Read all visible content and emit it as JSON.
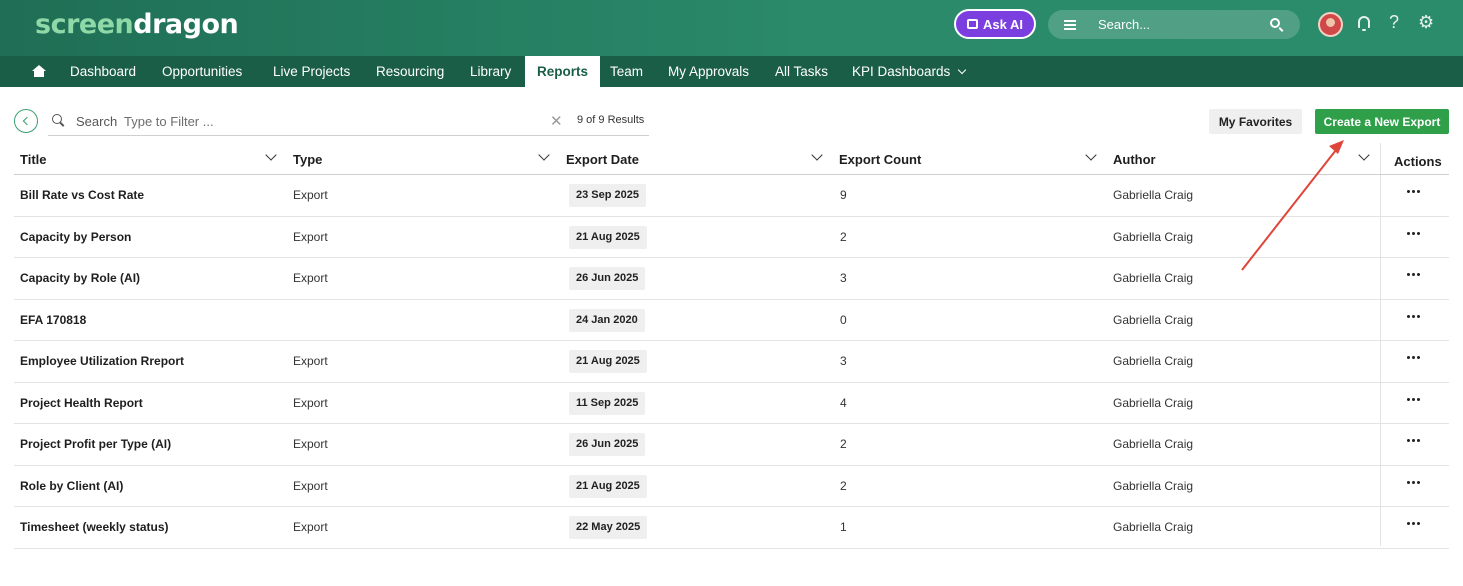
{
  "brand": {
    "part1": "screen",
    "part2": "dragon"
  },
  "header": {
    "ask_ai_label": "Ask AI",
    "search_placeholder": "Search..."
  },
  "nav": {
    "items": [
      {
        "label": "Dashboard"
      },
      {
        "label": "Opportunities"
      },
      {
        "label": "Live Projects"
      },
      {
        "label": "Resourcing"
      },
      {
        "label": "Library"
      },
      {
        "label": "Reports",
        "active": true
      },
      {
        "label": "Team"
      },
      {
        "label": "My Approvals"
      },
      {
        "label": "All Tasks"
      },
      {
        "label": "KPI Dashboards",
        "has_dropdown": true
      }
    ]
  },
  "toolbar": {
    "search_label": "Search",
    "filter_placeholder": "Type to Filter ...",
    "results_count": "9 of 9 Results",
    "favorites_label": "My Favorites",
    "create_label": "Create a New Export"
  },
  "table": {
    "columns": [
      "Title",
      "Type",
      "Export Date",
      "Export Count",
      "Author",
      "Actions"
    ],
    "rows": [
      {
        "title": "Bill Rate vs Cost Rate",
        "type": "Export",
        "date": "23 Sep 2025",
        "count": "9",
        "author": "Gabriella Craig"
      },
      {
        "title": "Capacity by Person",
        "type": "Export",
        "date": "21 Aug 2025",
        "count": "2",
        "author": "Gabriella Craig"
      },
      {
        "title": "Capacity by Role (AI)",
        "type": "Export",
        "date": "26 Jun 2025",
        "count": "3",
        "author": "Gabriella Craig"
      },
      {
        "title": "EFA 170818",
        "type": "",
        "date": "24 Jan 2020",
        "count": "0",
        "author": "Gabriella Craig"
      },
      {
        "title": "Employee Utilization Rreport",
        "type": "Export",
        "date": "21 Aug 2025",
        "count": "3",
        "author": "Gabriella Craig"
      },
      {
        "title": "Project Health Report",
        "type": "Export",
        "date": "11 Sep 2025",
        "count": "4",
        "author": "Gabriella Craig"
      },
      {
        "title": "Project Profit per Type (AI)",
        "type": "Export",
        "date": "26 Jun 2025",
        "count": "2",
        "author": "Gabriella Craig"
      },
      {
        "title": "Role by Client (AI)",
        "type": "Export",
        "date": "21 Aug 2025",
        "count": "2",
        "author": "Gabriella Craig"
      },
      {
        "title": "Timesheet (weekly status)",
        "type": "Export",
        "date": "22 May 2025",
        "count": "1",
        "author": "Gabriella Craig"
      }
    ]
  },
  "colors": {
    "header_green": "#2a8a6a",
    "nav_green": "#1b5e48",
    "ask_ai_purple": "#7b3fe0",
    "create_button_green": "#2f9f4a",
    "annotation_arrow": "#e0453a"
  }
}
